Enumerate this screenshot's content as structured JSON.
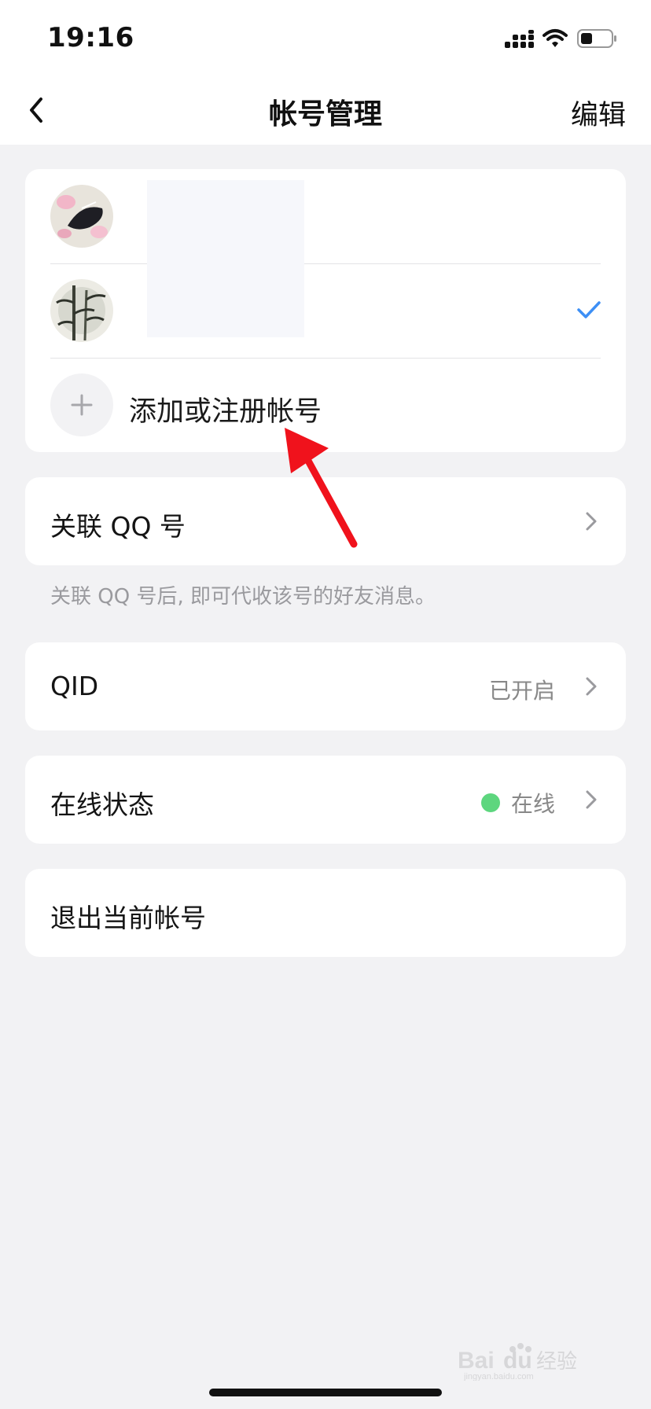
{
  "status_bar": {
    "time": "19:16",
    "icons": [
      "signal-icon",
      "wifi-icon",
      "battery-icon"
    ]
  },
  "header": {
    "title": "帐号管理",
    "edit_label": "编辑",
    "back_icon": "chevron-left-icon"
  },
  "accounts": {
    "items": [
      {
        "avatar": "avatar-ink-flowers",
        "selected": false
      },
      {
        "avatar": "avatar-bamboo",
        "selected": true
      }
    ],
    "add_label": "添加或注册帐号"
  },
  "linked_qq": {
    "label": "关联 QQ 号",
    "hint": "关联 QQ 号后, 即可代收该号的好友消息。"
  },
  "qid": {
    "label": "QID",
    "value": "已开启"
  },
  "online_status": {
    "label": "在线状态",
    "value": "在线",
    "dot_color": "#5dd67e"
  },
  "logout": {
    "label": "退出当前帐号"
  },
  "colors": {
    "accent": "#3d8ff5",
    "annotation_arrow": "#f0121c",
    "background": "#f2f2f4"
  },
  "watermark": {
    "text": "Baidu经验",
    "subtext": "jingyan.baidu.com"
  }
}
